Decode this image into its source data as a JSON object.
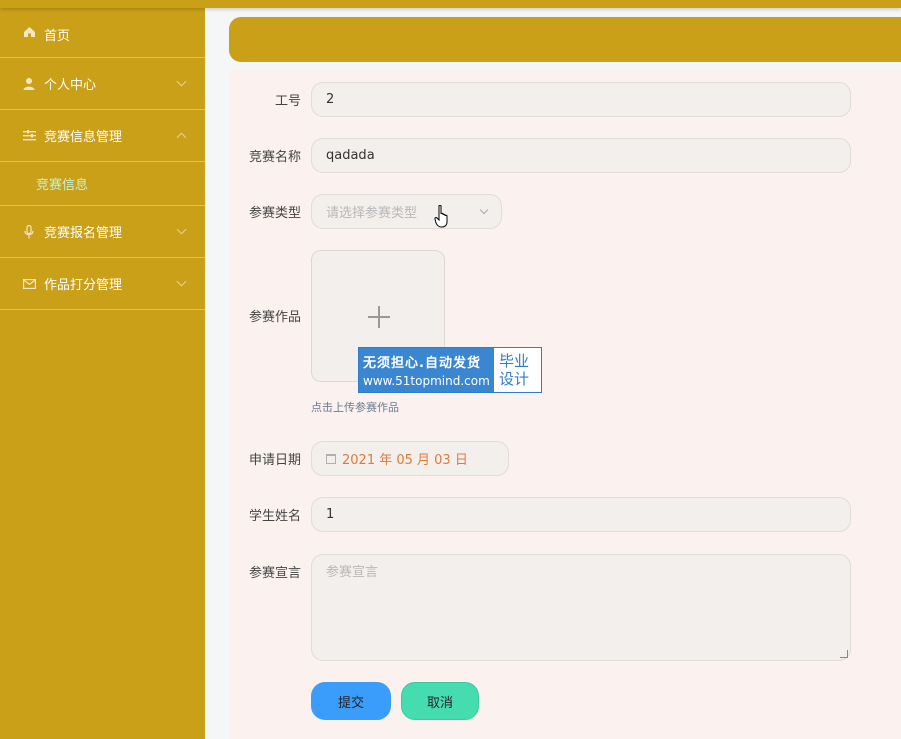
{
  "sidebar": {
    "items": [
      {
        "label": "首页",
        "icon": "home-icon"
      },
      {
        "label": "个人中心",
        "icon": "user-icon"
      },
      {
        "label": "竞赛信息管理",
        "icon": "list-icon"
      },
      {
        "label": "竞赛报名管理",
        "icon": "mic-icon"
      },
      {
        "label": "作品打分管理",
        "icon": "mail-icon"
      }
    ],
    "subitem": {
      "label": "竞赛信息"
    }
  },
  "form": {
    "job_no": {
      "label": "工号",
      "value": "2"
    },
    "contest_name": {
      "label": "竞赛名称",
      "value": "qadada"
    },
    "contest_type": {
      "label": "参赛类型",
      "placeholder": "请选择参赛类型"
    },
    "work": {
      "label": "参赛作品",
      "hint": "点击上传参赛作品"
    },
    "apply_date": {
      "label": "申请日期",
      "value": "2021 年 05 月 03 日"
    },
    "student_name": {
      "label": "学生姓名",
      "value": "1"
    },
    "declaration": {
      "label": "参赛宣言",
      "placeholder": "参赛宣言"
    },
    "submit_label": "提交",
    "cancel_label": "取消"
  },
  "watermark": {
    "line1": "无须担心.自动发货",
    "line2": "www.51topmind.com",
    "right1": "毕业",
    "right2": "设计"
  },
  "colors": {
    "sidebar": "#c9a018",
    "panel": "#fbf2ef",
    "submit": "#3b9dfb",
    "cancel": "#45dcb0",
    "date": "#e07b3a"
  }
}
